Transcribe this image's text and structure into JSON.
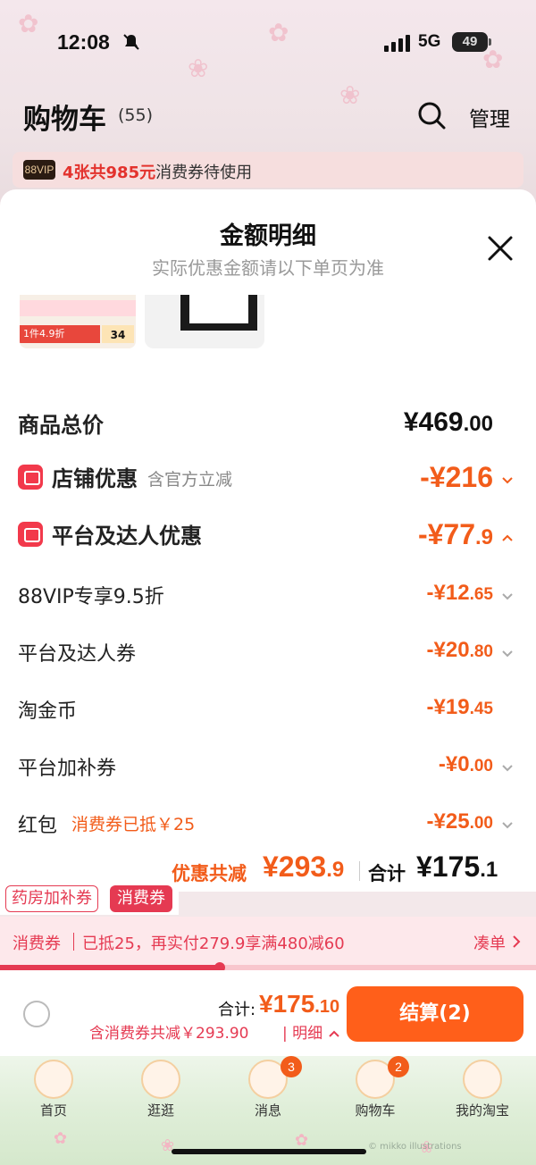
{
  "status": {
    "time": "12:08",
    "network": "5G",
    "battery": "49"
  },
  "header": {
    "title": "购物车",
    "count": "(55)",
    "manage_label": "管理"
  },
  "vip_strip": {
    "badge": "88VIP",
    "highlight": "4张共985元",
    "text": "消费券待使用"
  },
  "sheet": {
    "title": "金额明细",
    "subtitle": "实际优惠金额请以下单页为准",
    "thumb1": {
      "bar": "1件4.9折",
      "tag": "34"
    },
    "rows": [
      {
        "label": "商品总价",
        "value": "¥469",
        "dec": ".00"
      },
      {
        "label": "店铺优惠",
        "note": "含官方立减",
        "value": "-¥216",
        "dec": ""
      },
      {
        "label": "平台及达人优惠",
        "value": "-¥77",
        "dec": ".9"
      },
      {
        "label": "88VIP专享9.5折",
        "value": "-¥12",
        "dec": ".65"
      },
      {
        "label": "平台及达人券",
        "value": "-¥20",
        "dec": ".80"
      },
      {
        "label": "淘金币",
        "value": "-¥19",
        "dec": ".45"
      },
      {
        "label": "平台加补券",
        "value": "-¥0",
        "dec": ".00"
      },
      {
        "label": "红包",
        "note": "消费券已抵￥25",
        "value": "-¥25",
        "dec": ".00"
      }
    ],
    "summary": {
      "discount_label": "优惠共减",
      "discount_value": "¥293",
      "discount_dec": ".9",
      "total_label": "合计",
      "total_value": "¥175",
      "total_dec": ".1"
    }
  },
  "tags": {
    "pharmacy": "药房加补券",
    "voucher": "消费券"
  },
  "voucher_bar": {
    "label": "消费券",
    "text": "已抵25，再实付279.9享满480减60",
    "link": "凑单",
    "progress": 0.41
  },
  "checkout": {
    "total_label": "合计:",
    "total_value": "¥175",
    "total_dec": ".10",
    "discount_line": "含消费券共减￥293.90",
    "detail_link": "| 明细",
    "button": "结算(2)"
  },
  "tabs": [
    {
      "label": "首页",
      "badge": ""
    },
    {
      "label": "逛逛",
      "badge": ""
    },
    {
      "label": "消息",
      "badge": "3"
    },
    {
      "label": "购物车",
      "badge": "2"
    },
    {
      "label": "我的淘宝",
      "badge": ""
    }
  ],
  "credit": "© mikko illustrations",
  "colors": {
    "accent": "#f25c1a",
    "brand_red": "#e53a52",
    "checkout": "#ff5f1a"
  }
}
